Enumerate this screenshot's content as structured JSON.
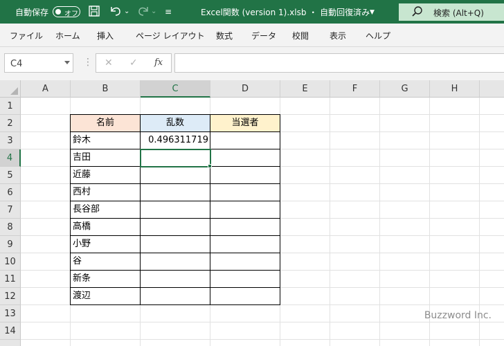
{
  "titlebar": {
    "autosave_label": "自動保存",
    "autosave_state": "オフ",
    "file_title": "Excel関数 (version 1).xlsb  ・  自動回復済み",
    "search_label": "検索 (Alt+Q)"
  },
  "ribbon": {
    "tabs": [
      "ファイル",
      "ホーム",
      "挿入",
      "ページ レイアウト",
      "数式",
      "データ",
      "校閲",
      "表示",
      "ヘルプ"
    ]
  },
  "formula_bar": {
    "name_box": "C4",
    "fx_label": "fx",
    "formula": ""
  },
  "sheet": {
    "columns": [
      "A",
      "B",
      "C",
      "D",
      "E",
      "F",
      "G",
      "H"
    ],
    "rows": [
      "1",
      "2",
      "3",
      "4",
      "5",
      "6",
      "7",
      "8",
      "9",
      "10",
      "11",
      "12",
      "13",
      "14"
    ],
    "selected_cell": "C4",
    "headers": {
      "name": "名前",
      "random": "乱数",
      "winner": "当選者"
    },
    "header_colors": {
      "name": "#fce4d6",
      "random": "#ddebf7",
      "winner": "#fff2cc"
    },
    "names": [
      "鈴木",
      "吉田",
      "近藤",
      "西村",
      "長谷部",
      "高橋",
      "小野",
      "谷",
      "新条",
      "渡辺"
    ],
    "random_values": [
      "0.496311719",
      "",
      "",
      "",
      "",
      "",
      "",
      "",
      "",
      ""
    ]
  },
  "watermark": "Buzzword Inc."
}
